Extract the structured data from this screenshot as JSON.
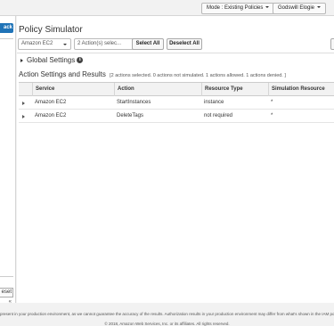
{
  "topbar": {
    "mode_label": "Mode : Existing Policies",
    "user_label": "Godswill Elogie"
  },
  "sidebar": {
    "back_label": "ack",
    "reset_label": "eset",
    "nav_label": "«"
  },
  "main": {
    "title": "Policy Simulator",
    "service_select": "Amazon EC2",
    "actions_select": "2 Action(s) selec...",
    "select_all_label": "Select All",
    "deselect_all_label": "Deselect All",
    "global_settings_label": "Global Settings",
    "results_title": "Action Settings and Results",
    "results_summary": "[2 actions selected. 0 actions not simulated. 1 actions allowed. 1 actions denied. ]"
  },
  "table": {
    "columns": [
      "Service",
      "Action",
      "Resource Type",
      "Simulation Resource"
    ],
    "rows": [
      [
        "Amazon EC2",
        "StartInstances",
        "instance",
        "*"
      ],
      [
        "Amazon EC2",
        "DeleteTags",
        "not required",
        "*"
      ]
    ]
  },
  "footer": {
    "disclaimer": "present in your production environment, as we cannot guarantee the accuracy of the results. Authorization results in your production environment may differ from what's shown in the IAM policy simulator therefore",
    "copyright": "© 2018, Amazon Web Services, Inc. or its affiliates. All rights reserved."
  },
  "colors": {
    "accent": "#1f73b7",
    "page_bg": "#f2f2f2"
  },
  "icons": [
    "caret-down-icon",
    "expand-triangle-icon",
    "info-icon"
  ]
}
